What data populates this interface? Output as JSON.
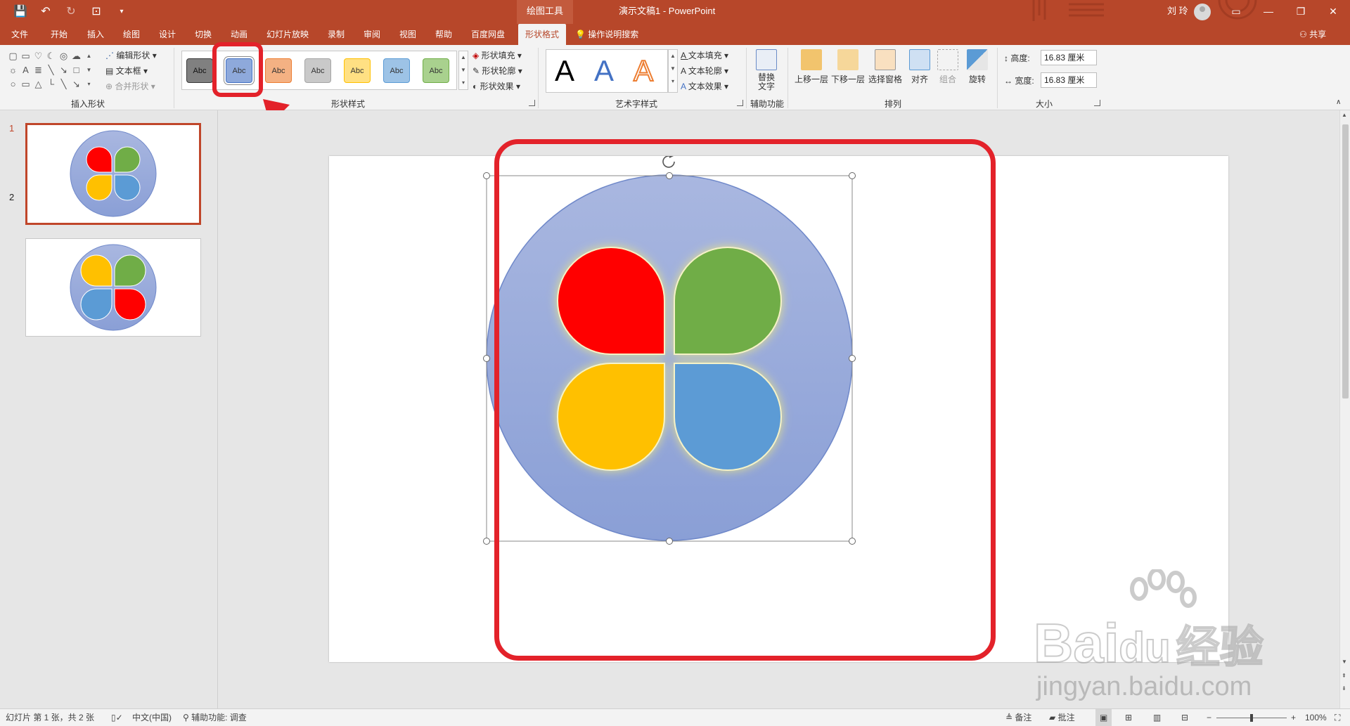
{
  "titlebar": {
    "context_tool": "绘图工具",
    "doc_title": "演示文稿1  -  PowerPoint",
    "user_name": "刘 玲",
    "minimize": "—",
    "restore": "❐",
    "close": "✕",
    "ribbon_display": "▭"
  },
  "tabs": {
    "items": [
      {
        "label": "文件"
      },
      {
        "label": "开始"
      },
      {
        "label": "插入"
      },
      {
        "label": "绘图"
      },
      {
        "label": "设计"
      },
      {
        "label": "切换"
      },
      {
        "label": "动画"
      },
      {
        "label": "幻灯片放映"
      },
      {
        "label": "录制"
      },
      {
        "label": "审阅"
      },
      {
        "label": "视图"
      },
      {
        "label": "帮助"
      },
      {
        "label": "百度网盘"
      },
      {
        "label": "形状格式"
      }
    ],
    "search_label": "操作说明搜索",
    "share_label": "共享"
  },
  "ribbon": {
    "insert_shapes": {
      "label": "插入形状",
      "edit_shape": "编辑形状",
      "text_box": "文本框",
      "merge_shapes": "合并形状"
    },
    "shape_styles": {
      "label": "形状样式",
      "swatch_text": "Abc",
      "swatches": [
        {
          "color": "#808080",
          "border": "#3a3a3a"
        },
        {
          "color": "#8ea9db",
          "border": "#4472c4"
        },
        {
          "color": "#f4b183",
          "border": "#ed7d31"
        },
        {
          "color": "#c9c9c9",
          "border": "#a5a5a5"
        },
        {
          "color": "#ffe083",
          "border": "#ffc000"
        },
        {
          "color": "#9dc3e6",
          "border": "#5b9bd5"
        },
        {
          "color": "#a9d18e",
          "border": "#70ad47"
        }
      ],
      "fill": "形状填充",
      "outline": "形状轮廓",
      "effects": "形状效果"
    },
    "wordart": {
      "label": "艺术字样式",
      "sample": "A",
      "text_fill": "文本填充",
      "text_outline": "文本轮廓",
      "text_effects": "文本效果"
    },
    "accessibility": {
      "label": "辅助功能",
      "alt_text": "替换\n文字"
    },
    "arrange": {
      "label": "排列",
      "bring_forward": "上移一层",
      "send_backward": "下移一层",
      "selection_pane": "选择窗格",
      "align": "对齐",
      "group": "组合",
      "rotate": "旋转"
    },
    "size": {
      "label": "大小",
      "height_label": "高度:",
      "height_value": "16.83 厘米",
      "width_label": "宽度:",
      "width_value": "16.83 厘米"
    }
  },
  "thumbnails": [
    {
      "number": "1",
      "quadrants": [
        "#ff0000",
        "#70ad47",
        "#ffc000",
        "#5b9bd5"
      ]
    },
    {
      "number": "2",
      "quadrants": [
        "#ffc000",
        "#70ad47",
        "#5b9bd5",
        "#ff0000"
      ]
    }
  ],
  "slide": {
    "outer_circle_gradient": [
      "#a9b7e0",
      "#8a9fd6"
    ],
    "petals": [
      {
        "name": "red",
        "color": "#ff0000"
      },
      {
        "name": "green",
        "color": "#70ad47"
      },
      {
        "name": "yellow",
        "color": "#ffc000"
      },
      {
        "name": "blue",
        "color": "#5b9bd5"
      }
    ]
  },
  "statusbar": {
    "slide_info": "幻灯片 第 1 张，共 2 张",
    "language": "中文(中国)",
    "accessibility": "辅助功能: 调查",
    "notes": "备注",
    "comments": "批注",
    "zoom": "100%"
  },
  "watermark": {
    "brand": "Bai",
    "brand2": "du",
    "brand_cn": "经验",
    "url": "jingyan.baidu.com"
  },
  "colors": {
    "accent": "#b7472a",
    "annotation": "#e3222a"
  }
}
